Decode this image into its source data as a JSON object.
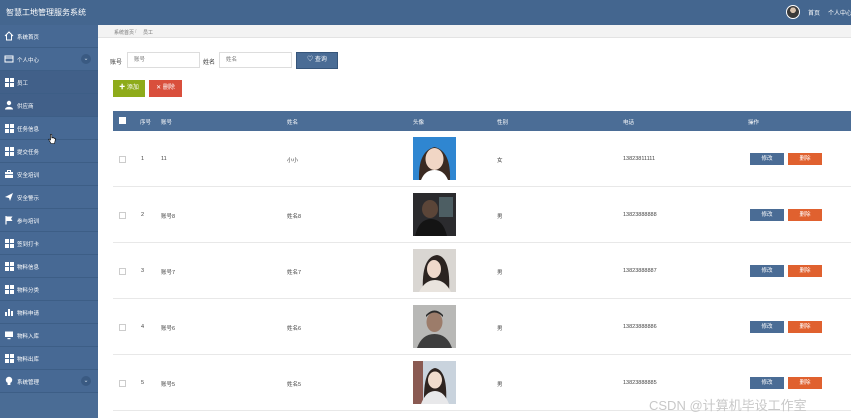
{
  "header": {
    "title": "智慧工地管理服务系统",
    "home": "首页",
    "profile": "个人中心"
  },
  "sidebar": {
    "items": [
      {
        "label": "系统首页",
        "icon": "home-icon"
      },
      {
        "label": "个人中心",
        "icon": "window-icon",
        "expand": "⌄"
      },
      {
        "label": "员工",
        "icon": "grid-icon"
      },
      {
        "label": "供应商",
        "icon": "user-icon"
      },
      {
        "label": "任务信息",
        "icon": "grid-icon"
      },
      {
        "label": "提交任务",
        "icon": "grid-icon"
      },
      {
        "label": "安全培训",
        "icon": "briefcase-icon"
      },
      {
        "label": "安全警示",
        "icon": "send-icon"
      },
      {
        "label": "参与培训",
        "icon": "flag-icon"
      },
      {
        "label": "签到打卡",
        "icon": "grid-icon"
      },
      {
        "label": "物料信息",
        "icon": "grid-icon"
      },
      {
        "label": "物料分类",
        "icon": "grid-icon"
      },
      {
        "label": "物料申请",
        "icon": "bar-chart-icon"
      },
      {
        "label": "物料入库",
        "icon": "monitor-icon"
      },
      {
        "label": "物料出库",
        "icon": "grid-icon"
      },
      {
        "label": "系统管理",
        "icon": "bulb-icon",
        "expand": "⌄"
      }
    ]
  },
  "breadcrumb": {
    "root": "系统首页",
    "separator": "/",
    "current": "员工"
  },
  "search": {
    "account_label": "账号",
    "account_placeholder": "账号",
    "name_label": "姓名",
    "name_placeholder": "姓名",
    "button": "查询"
  },
  "actions": {
    "add": "添加",
    "delete": "删除"
  },
  "table": {
    "columns": [
      "序号",
      "账号",
      "姓名",
      "头像",
      "性别",
      "电话",
      "操作"
    ],
    "edit_label": "修改",
    "delete_label": "删除",
    "rows": [
      {
        "index": "1",
        "account": "11",
        "name": "小小",
        "gender": "女",
        "phone": "13823811111"
      },
      {
        "index": "2",
        "account": "账号8",
        "name": "姓名8",
        "gender": "男",
        "phone": "13823888888"
      },
      {
        "index": "3",
        "account": "账号7",
        "name": "姓名7",
        "gender": "男",
        "phone": "13823888887"
      },
      {
        "index": "4",
        "account": "账号6",
        "name": "姓名6",
        "gender": "男",
        "phone": "13823888886"
      },
      {
        "index": "5",
        "account": "账号5",
        "name": "姓名5",
        "gender": "男",
        "phone": "13823888885"
      }
    ]
  },
  "watermark": "CSDN @计算机毕设工作室",
  "colors": {
    "header": "#44668f",
    "sidebar": "#476994",
    "table_header": "#4b6d96",
    "add_button": "#8eab1a",
    "delete_button": "#d94f3c",
    "row_delete_button": "#e0612f"
  }
}
